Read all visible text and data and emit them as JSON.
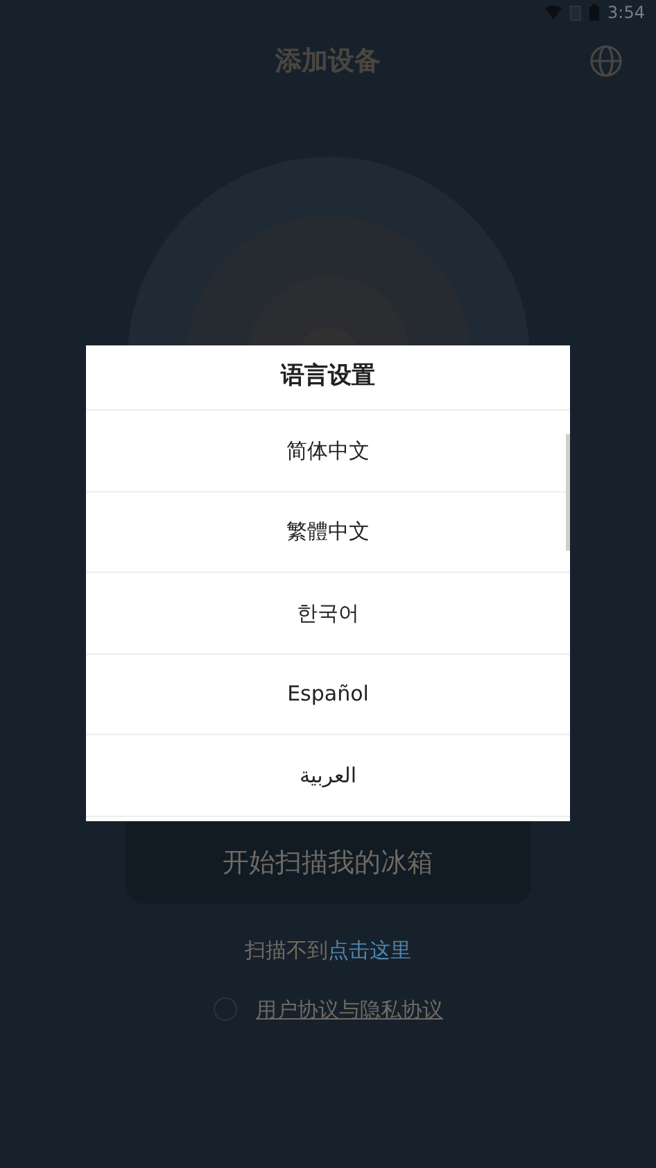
{
  "status_bar": {
    "time": "3:54"
  },
  "header": {
    "title": "添加设备"
  },
  "start_button": {
    "label": "开始扫描我的冰箱"
  },
  "help": {
    "text": "扫描不到",
    "link": "点击这里"
  },
  "agreement": {
    "checked": false,
    "label": "用户协议与隐私协议"
  },
  "language_dialog": {
    "title": "语言设置",
    "options": [
      {
        "label": "简体中文"
      },
      {
        "label": "繁體中文"
      },
      {
        "label": "한국어"
      },
      {
        "label": "Español"
      },
      {
        "label": "العربية"
      }
    ]
  }
}
